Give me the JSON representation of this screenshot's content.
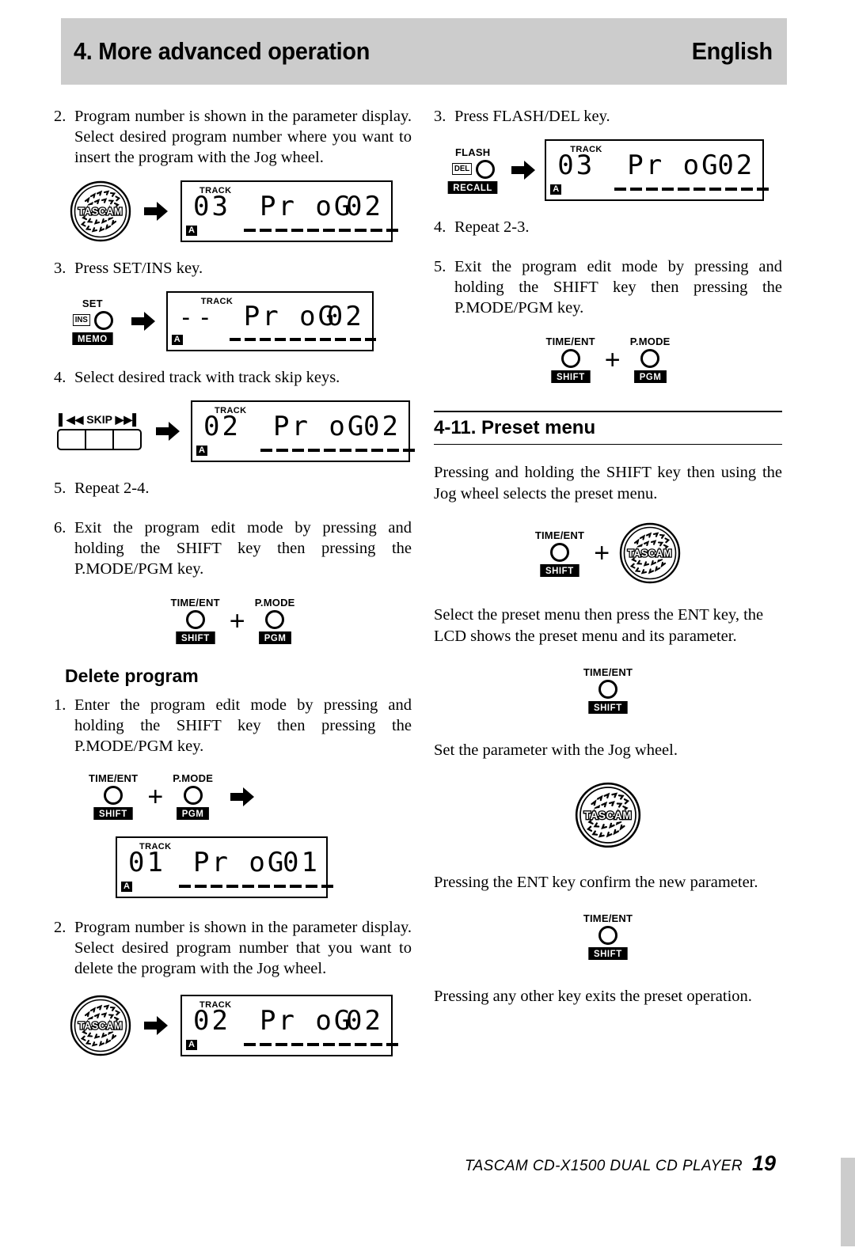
{
  "header": {
    "title": "4. More advanced operation",
    "language": "English"
  },
  "left_column": {
    "steps": [
      {
        "num": "2.",
        "text": "Program number is shown in the parameter display.  Select desired program number where you want to insert the program with the Jog wheel."
      },
      {
        "num": "3.",
        "text": "Press SET/INS key."
      },
      {
        "num": "4.",
        "text": "Select desired track with track skip keys."
      },
      {
        "num": "5.",
        "text": "Repeat 2-4."
      },
      {
        "num": "6.",
        "text": "Exit the program edit mode by pressing and holding the SHIFT key then pressing the P.MODE/PGM key."
      }
    ],
    "figures": {
      "jog_to_lcd_1": {
        "jog_label": "TASCAM",
        "arrow": "right-arrow",
        "lcd": {
          "track_label": "TRACK",
          "track_num": "03",
          "mode": "Pr oG",
          "param": "02",
          "indicator": "A",
          "dashes": 10
        }
      },
      "setins_to_lcd": {
        "key": {
          "top": "SET",
          "side": "INS",
          "bottom": "MEMO"
        },
        "arrow": "right-arrow",
        "lcd": {
          "track_label": "TRACK",
          "track_num": "--",
          "mode": "Pr oG",
          "param": "02",
          "indicator": "A",
          "dashes": 10
        }
      },
      "skip_to_lcd": {
        "skip_label": "SKIP",
        "skip_left_icon": "skip-back-icon",
        "skip_right_icon": "skip-forward-icon",
        "arrow": "right-arrow",
        "lcd": {
          "track_label": "TRACK",
          "track_num": "02",
          "mode": "Pr oG",
          "param": "02",
          "indicator": "A",
          "dashes": 10
        }
      },
      "shift_plus_pgm_1": {
        "key_a": {
          "top": "TIME/ENT",
          "bottom": "SHIFT"
        },
        "plus": "+",
        "key_b": {
          "top": "P.MODE",
          "bottom": "PGM"
        }
      }
    },
    "delete_program": {
      "heading": "Delete program",
      "steps": [
        {
          "num": "1.",
          "text": "Enter the program edit mode by pressing and holding the SHIFT key then pressing the P.MODE/PGM key."
        },
        {
          "num": "2.",
          "text": "Program number is shown in the parameter display.  Select desired program number that you want to delete the program with the Jog wheel."
        }
      ],
      "figures": {
        "shift_plus_pgm_arrow": {
          "key_a": {
            "top": "TIME/ENT",
            "bottom": "SHIFT"
          },
          "plus": "+",
          "key_b": {
            "top": "P.MODE",
            "bottom": "PGM"
          },
          "arrow": "right-arrow"
        },
        "lcd_big": {
          "track_label": "TRACK",
          "track_num": "01",
          "mode": "Pr oG",
          "param": "01",
          "indicator": "A",
          "dashes": 10
        },
        "jog_to_lcd_2": {
          "jog_label": "TASCAM",
          "arrow": "right-arrow",
          "lcd": {
            "track_label": "TRACK",
            "track_num": "02",
            "mode": "Pr oG",
            "param": "02",
            "indicator": "A",
            "dashes": 10
          }
        }
      }
    }
  },
  "right_column": {
    "steps": [
      {
        "num": "3.",
        "text": "Press FLASH/DEL key."
      },
      {
        "num": "4.",
        "text": "Repeat 2-3."
      },
      {
        "num": "5.",
        "text": "Exit the program edit mode by pressing and holding the SHIFT key then pressing the P.MODE/PGM key."
      }
    ],
    "figures": {
      "flashdel_to_lcd": {
        "key": {
          "top": "FLASH",
          "side": "DEL",
          "bottom": "RECALL"
        },
        "arrow": "right-arrow",
        "lcd": {
          "track_label": "TRACK",
          "track_num": "03",
          "mode": "Pr oG",
          "param": "02",
          "indicator": "A",
          "dashes": 10
        }
      },
      "shift_plus_pgm_2": {
        "key_a": {
          "top": "TIME/ENT",
          "bottom": "SHIFT"
        },
        "plus": "+",
        "key_b": {
          "top": "P.MODE",
          "bottom": "PGM"
        }
      },
      "shift_plus_jog": {
        "key_a": {
          "top": "TIME/ENT",
          "bottom": "SHIFT"
        },
        "plus": "+",
        "jog_label": "TASCAM"
      },
      "shift_key_1": {
        "top": "TIME/ENT",
        "bottom": "SHIFT"
      },
      "jog_alone": {
        "jog_label": "TASCAM"
      },
      "shift_key_2": {
        "top": "TIME/ENT",
        "bottom": "SHIFT"
      }
    },
    "preset_menu": {
      "heading": "4-11. Preset menu",
      "paragraphs": [
        "Pressing and holding the SHIFT key then using the Jog wheel selects the preset menu.",
        "Select the preset menu then press the ENT key, the LCD shows the preset menu and its parameter.",
        "Set the parameter with the Jog wheel.",
        "Pressing the ENT key confirm the new parameter.",
        "Pressing any other key exits the preset operation."
      ]
    }
  },
  "footer": {
    "text": "TASCAM  CD-X1500  DUAL CD PLAYER",
    "page": "19"
  },
  "colors": {
    "banner": "#cccccc",
    "ink": "#000000",
    "paper": "#ffffff"
  }
}
